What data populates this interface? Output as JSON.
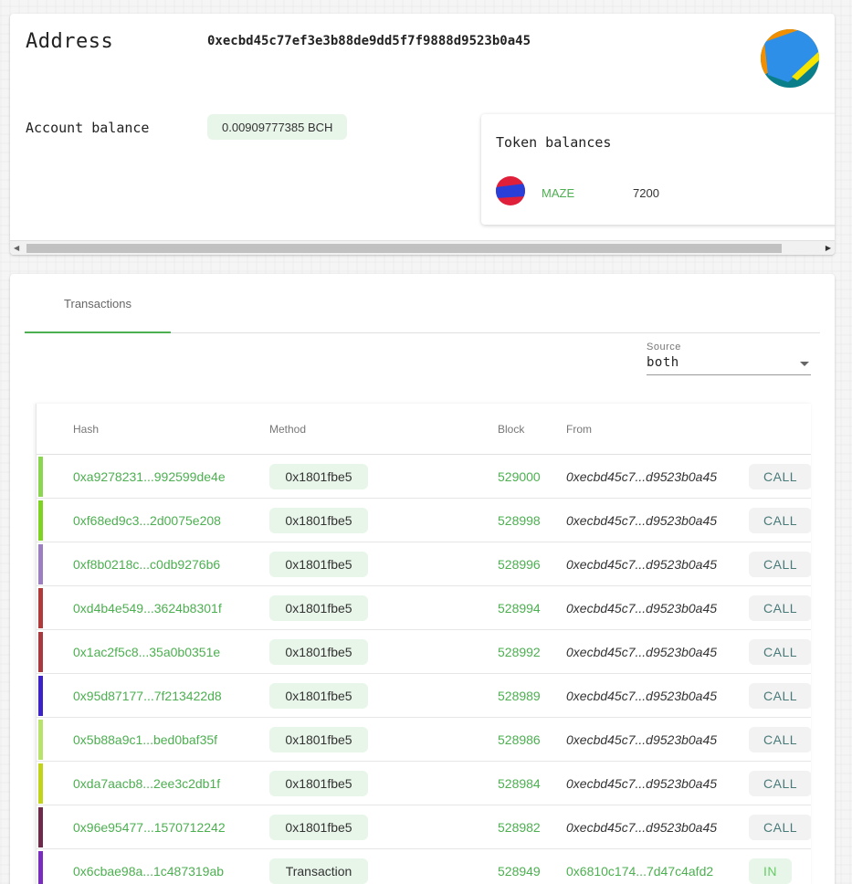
{
  "address": {
    "label": "Address",
    "value": "0xecbd45c77ef3e3b88de9dd5f7f9888d9523b0a45"
  },
  "account_balance": {
    "label": "Account balance",
    "value": "0.00909777385 BCH"
  },
  "token_balances": {
    "title": "Token balances",
    "items": [
      {
        "name": "MAZE",
        "amount": "7200"
      }
    ]
  },
  "tabs": [
    {
      "label": "Transactions",
      "active": true
    }
  ],
  "source": {
    "label": "Source",
    "value": "both"
  },
  "table": {
    "columns": [
      "Hash",
      "Method",
      "Block",
      "From"
    ],
    "rows": [
      {
        "color": "#8bd650",
        "hash": "0xa9278231...992599de4e",
        "method": "0x1801fbe5",
        "block": "529000",
        "from": "0xecbd45c7...d9523b0a45",
        "from_style": "italic",
        "dir": "CALL"
      },
      {
        "color": "#7ed321",
        "hash": "0xf68ed9c3...2d0075e208",
        "method": "0x1801fbe5",
        "block": "528998",
        "from": "0xecbd45c7...d9523b0a45",
        "from_style": "italic",
        "dir": "CALL"
      },
      {
        "color": "#9b7fc0",
        "hash": "0xf8b0218c...c0db9276b6",
        "method": "0x1801fbe5",
        "block": "528996",
        "from": "0xecbd45c7...d9523b0a45",
        "from_style": "italic",
        "dir": "CALL"
      },
      {
        "color": "#b03a3a",
        "hash": "0xd4b4e549...3624b8301f",
        "method": "0x1801fbe5",
        "block": "528994",
        "from": "0xecbd45c7...d9523b0a45",
        "from_style": "italic",
        "dir": "CALL"
      },
      {
        "color": "#a8393f",
        "hash": "0x1ac2f5c8...35a0b0351e",
        "method": "0x1801fbe5",
        "block": "528992",
        "from": "0xecbd45c7...d9523b0a45",
        "from_style": "italic",
        "dir": "CALL"
      },
      {
        "color": "#3a22c8",
        "hash": "0x95d87177...7f213422d8",
        "method": "0x1801fbe5",
        "block": "528989",
        "from": "0xecbd45c7...d9523b0a45",
        "from_style": "italic",
        "dir": "CALL"
      },
      {
        "color": "#b8e36a",
        "hash": "0x5b88a9c1...bed0baf35f",
        "method": "0x1801fbe5",
        "block": "528986",
        "from": "0xecbd45c7...d9523b0a45",
        "from_style": "italic",
        "dir": "CALL"
      },
      {
        "color": "#c2d41a",
        "hash": "0xda7aacb8...2ee3c2db1f",
        "method": "0x1801fbe5",
        "block": "528984",
        "from": "0xecbd45c7...d9523b0a45",
        "from_style": "italic",
        "dir": "CALL"
      },
      {
        "color": "#6e2a4a",
        "hash": "0x96e95477...1570712242",
        "method": "0x1801fbe5",
        "block": "528982",
        "from": "0xecbd45c7...d9523b0a45",
        "from_style": "italic",
        "dir": "CALL"
      },
      {
        "color": "#7a2cc0",
        "hash": "0x6cbae98a...1c487319ab",
        "method": "Transaction",
        "block": "528949",
        "from": "0x6810c174...7d47c4afd2",
        "from_style": "link",
        "dir": "IN"
      }
    ]
  }
}
